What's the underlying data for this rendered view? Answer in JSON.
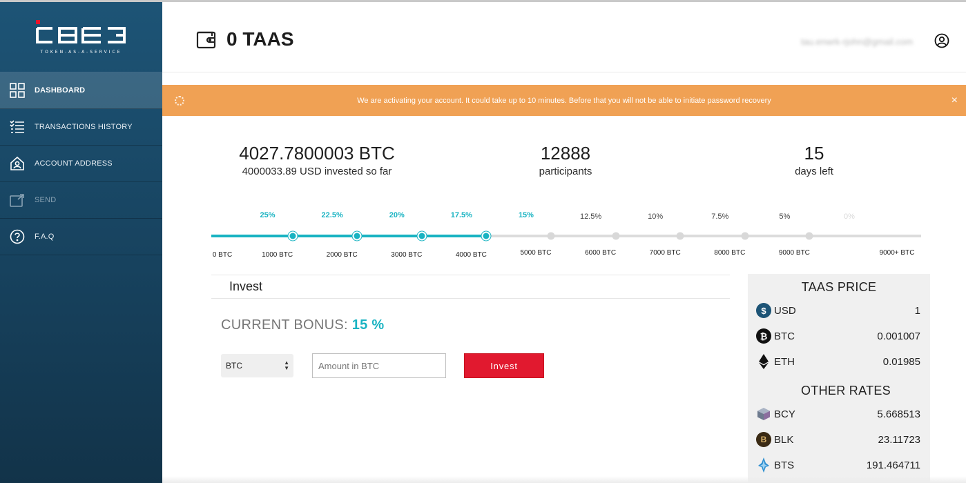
{
  "app": {
    "logo_tagline": "TOKEN-AS-A-SERVICE"
  },
  "sidebar": {
    "items": [
      {
        "label": "DASHBOARD",
        "icon": "grid-icon"
      },
      {
        "label": "TRANSACTIONS HISTORY",
        "icon": "list-icon"
      },
      {
        "label": "ACCOUNT ADDRESS",
        "icon": "house-user-icon"
      },
      {
        "label": "SEND",
        "icon": "send-icon"
      },
      {
        "label": "F.A.Q",
        "icon": "question-circle-icon"
      }
    ],
    "active_index": 0
  },
  "header": {
    "balance": "0 TAAS",
    "email": "tau.enwrk-rjohn@gmail.com"
  },
  "banner": {
    "message": "We are activating your account. It could take up to 10 minutes. Before that you will not be able to initiate password recovery",
    "close": "×"
  },
  "stats": {
    "raised_btc": "4027.7800003 BTC",
    "raised_usd": "4000033.89 USD invested so far",
    "participants_value": "12888",
    "participants_label": "participants",
    "days_value": "15",
    "days_label": "days left"
  },
  "progress": {
    "bonuses": [
      "25%",
      "22.5%",
      "20%",
      "17.5%",
      "15%",
      "12.5%",
      "10%",
      "7.5%",
      "5%",
      "0%"
    ],
    "ticks": [
      "0 BTC",
      "1000 BTC",
      "2000 BTC",
      "3000 BTC",
      "4000 BTC",
      "5000 BTC",
      "6000 BTC",
      "7000 BTC",
      "8000 BTC",
      "9000 BTC",
      "9000+ BTC"
    ],
    "current_btc": 4027.7800003,
    "active_tiers": 5,
    "colors": {
      "active": "#19b3c2",
      "inactive": "#dcdcdc"
    }
  },
  "invest": {
    "title": "Invest",
    "current_bonus_label": "CURRENT BONUS:",
    "current_bonus_value": "15 %",
    "currency": "BTC",
    "amount_placeholder": "Amount in BTC",
    "button_label": "Invest",
    "button_color": "#e1192f"
  },
  "prices": {
    "title": "TAAS PRICE",
    "rows": [
      {
        "symbol": "USD",
        "value": "1",
        "icon": "dollar-icon",
        "color": "#1d5476"
      },
      {
        "symbol": "BTC",
        "value": "0.001007",
        "icon": "bitcoin-icon",
        "color": "#111111"
      },
      {
        "symbol": "ETH",
        "value": "0.01985",
        "icon": "ethereum-icon",
        "color": "#111111"
      }
    ],
    "other_title": "OTHER RATES",
    "other_rows": [
      {
        "symbol": "BCY",
        "value": "5.668513",
        "icon": "bcy-cube-icon",
        "color": "#6d7a8e"
      },
      {
        "symbol": "BLK",
        "value": "23.11723",
        "icon": "blk-coin-icon",
        "color": "#3a2a14"
      },
      {
        "symbol": "BTS",
        "value": "191.464711",
        "icon": "bts-icon",
        "color": "#2e8fd1"
      }
    ]
  },
  "accent_color": "#19b3c2",
  "banner_color": "#f0a154"
}
